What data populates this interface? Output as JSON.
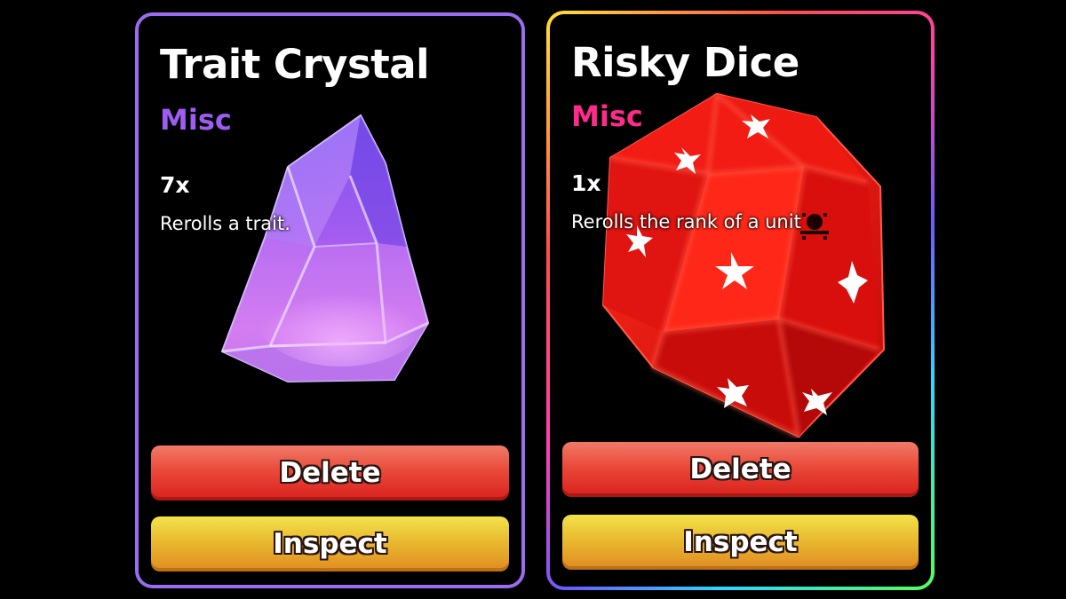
{
  "cards": [
    {
      "title": "Trait Crystal",
      "category": "Misc",
      "category_color": "#9d5cf2",
      "quantity": "7x",
      "description": "Rerolls a trait.",
      "border_color": "#9a6cf0",
      "icon": "purple-crystal-icon",
      "buttons": {
        "delete": "Delete",
        "inspect": "Inspect"
      }
    },
    {
      "title": "Risky Dice",
      "category": "Misc",
      "category_color": "#ff2a8a",
      "quantity": "1x",
      "description": "Rerolls the rank of a unit",
      "border_color": "rainbow",
      "icon": "red-d20-dice-icon",
      "buttons": {
        "delete": "Delete",
        "inspect": "Inspect"
      }
    }
  ]
}
